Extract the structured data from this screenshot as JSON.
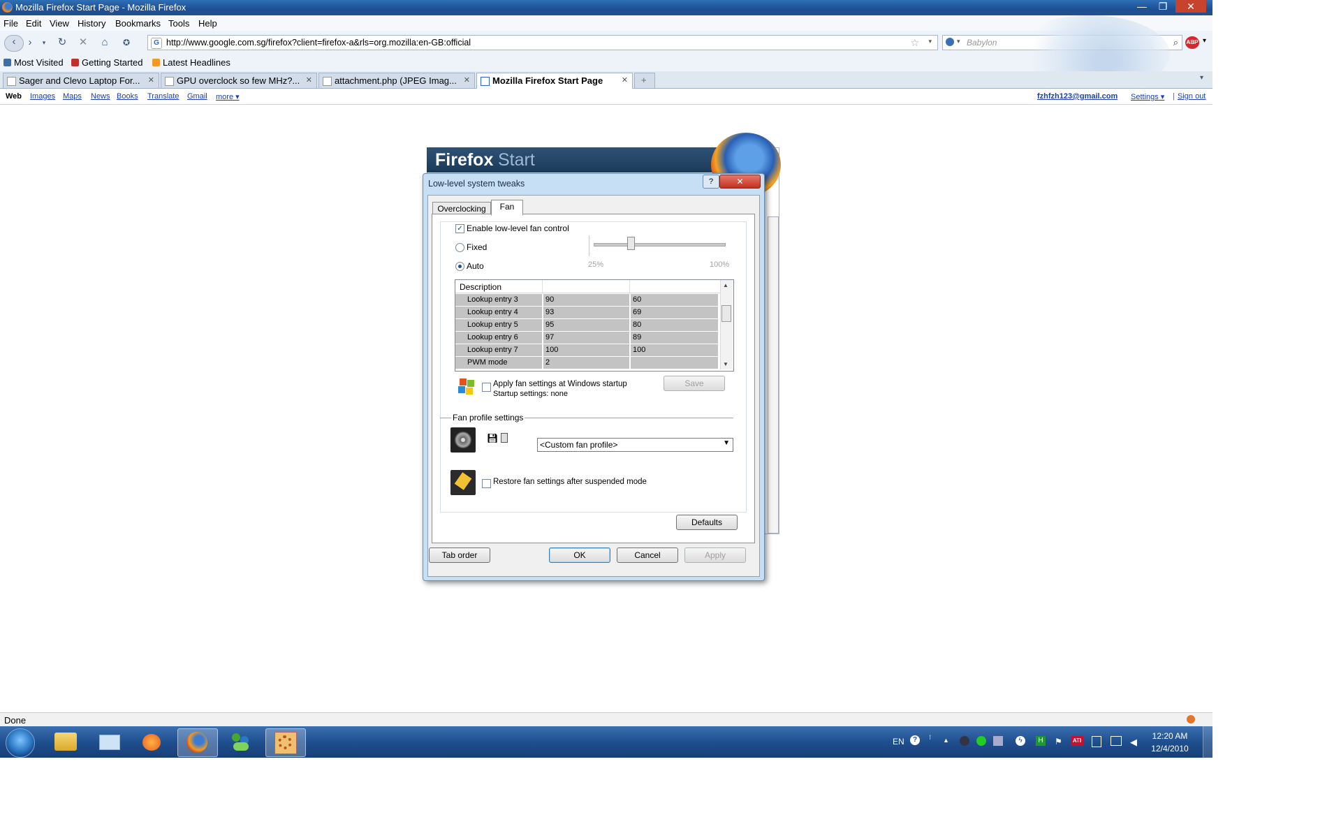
{
  "window": {
    "title": "Mozilla Firefox Start Page - Mozilla Firefox",
    "controls": {
      "minimize": "—",
      "maximize": "❐",
      "close": "✕"
    }
  },
  "menubar": [
    "File",
    "Edit",
    "View",
    "History",
    "Bookmarks",
    "Tools",
    "Help"
  ],
  "navbar": {
    "url": "http://www.google.com.sg/firefox?client=firefox-a&rls=org.mozilla:en-GB:official",
    "search_placeholder": "Babylon",
    "abp": "ABP"
  },
  "bookmarks": [
    {
      "label": "Most Visited",
      "icon": "most-visited-icon",
      "color": "#3f6ea5"
    },
    {
      "label": "Getting Started",
      "icon": "getting-started-icon",
      "color": "#c0302a"
    },
    {
      "label": "Latest Headlines",
      "icon": "rss-icon",
      "color": "#f39a22"
    }
  ],
  "tabs": [
    {
      "label": "Sager and Clevo Laptop For..."
    },
    {
      "label": "GPU overclock so few MHz?..."
    },
    {
      "label": "attachment.php (JPEG Imag..."
    },
    {
      "label": "Mozilla Firefox Start Page",
      "active": true
    }
  ],
  "googlebar": {
    "left": [
      "Web",
      "Images",
      "Maps",
      "News",
      "Books",
      "Translate",
      "Gmail",
      "more ▾"
    ],
    "account": "fzhfzh123@gmail.com",
    "settings": "Settings ▾",
    "separator": "|",
    "signout": "Sign out"
  },
  "start": {
    "word1": "Firefox",
    "word2": "Start"
  },
  "dialog": {
    "title": "Low-level system tweaks",
    "help": "?",
    "close": "✕",
    "tabs": [
      "Overclocking",
      "Fan"
    ],
    "enable_label": "Enable low-level fan control",
    "enable_checked": true,
    "fixed_label": "Fixed",
    "auto_label": "Auto",
    "slider_min": "25%",
    "slider_max": "100%",
    "slider_value_fraction": 0.27,
    "grid": {
      "header": [
        "Description",
        "",
        ""
      ],
      "rows": [
        [
          "Lookup entry 3",
          "90",
          "60"
        ],
        [
          "Lookup entry 4",
          "93",
          "69"
        ],
        [
          "Lookup entry 5",
          "95",
          "80"
        ],
        [
          "Lookup entry 6",
          "97",
          "89"
        ],
        [
          "Lookup entry 7",
          "100",
          "100"
        ],
        [
          "PWM mode",
          "2",
          ""
        ]
      ]
    },
    "apply_startup_label": "Apply fan settings at Windows startup",
    "startup_settings": "Startup settings: none",
    "save_label": "Save",
    "profile_section": "Fan profile settings",
    "profile_value": "<Custom fan profile>",
    "restore_label": "Restore fan settings after suspended mode",
    "defaults_label": "Defaults",
    "tab_order_label": "Tab order",
    "ok_label": "OK",
    "cancel_label": "Cancel",
    "apply_label": "Apply"
  },
  "status": {
    "text": "Done"
  },
  "taskbar": {
    "tray": {
      "lang": "EN",
      "clock_time": "12:20 AM",
      "clock_date": "12/4/2010"
    }
  }
}
